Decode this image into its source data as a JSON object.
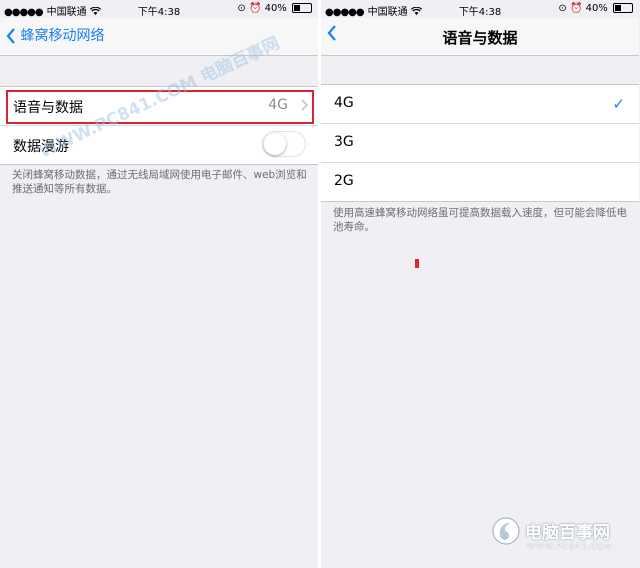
{
  "status_bar": {
    "carrier": "中国联通",
    "time": "下午4:38",
    "battery": "40%",
    "icons": [
      "signal-dots-icon",
      "wifi-icon",
      "lock-rotation-icon",
      "alarm-icon",
      "battery-icon"
    ],
    "battery_level": 0.4
  },
  "left_screen": {
    "nav_title": "蜂窝移动网络",
    "rows": [
      {
        "label": "语音与数据",
        "value": "4G"
      },
      {
        "label": "数据漫游",
        "toggle_on": false
      }
    ],
    "footnote": "关闭蜂窝移动数据，通过无线局域网使用电子邮件、web浏览和推送通知等所有数据。",
    "watermark": "WWW.PC841.COM 电脑百事网",
    "highlight_color": "#d62433"
  },
  "right_screen": {
    "nav_title": "语音与数据",
    "options": [
      {
        "label": "4G",
        "selected": true
      },
      {
        "label": "3G",
        "selected": false
      },
      {
        "label": "2G",
        "selected": false
      }
    ],
    "footnote": "使用高速蜂窝移动网络虽可提高数据载入速度，但可能会降低电池寿命。"
  },
  "brand": {
    "name": "电脑百事网",
    "url": "WWW.PC841.COM"
  },
  "colors": {
    "accent": "#1a7ef5",
    "background": "#efeff4",
    "highlight": "#d62433"
  }
}
